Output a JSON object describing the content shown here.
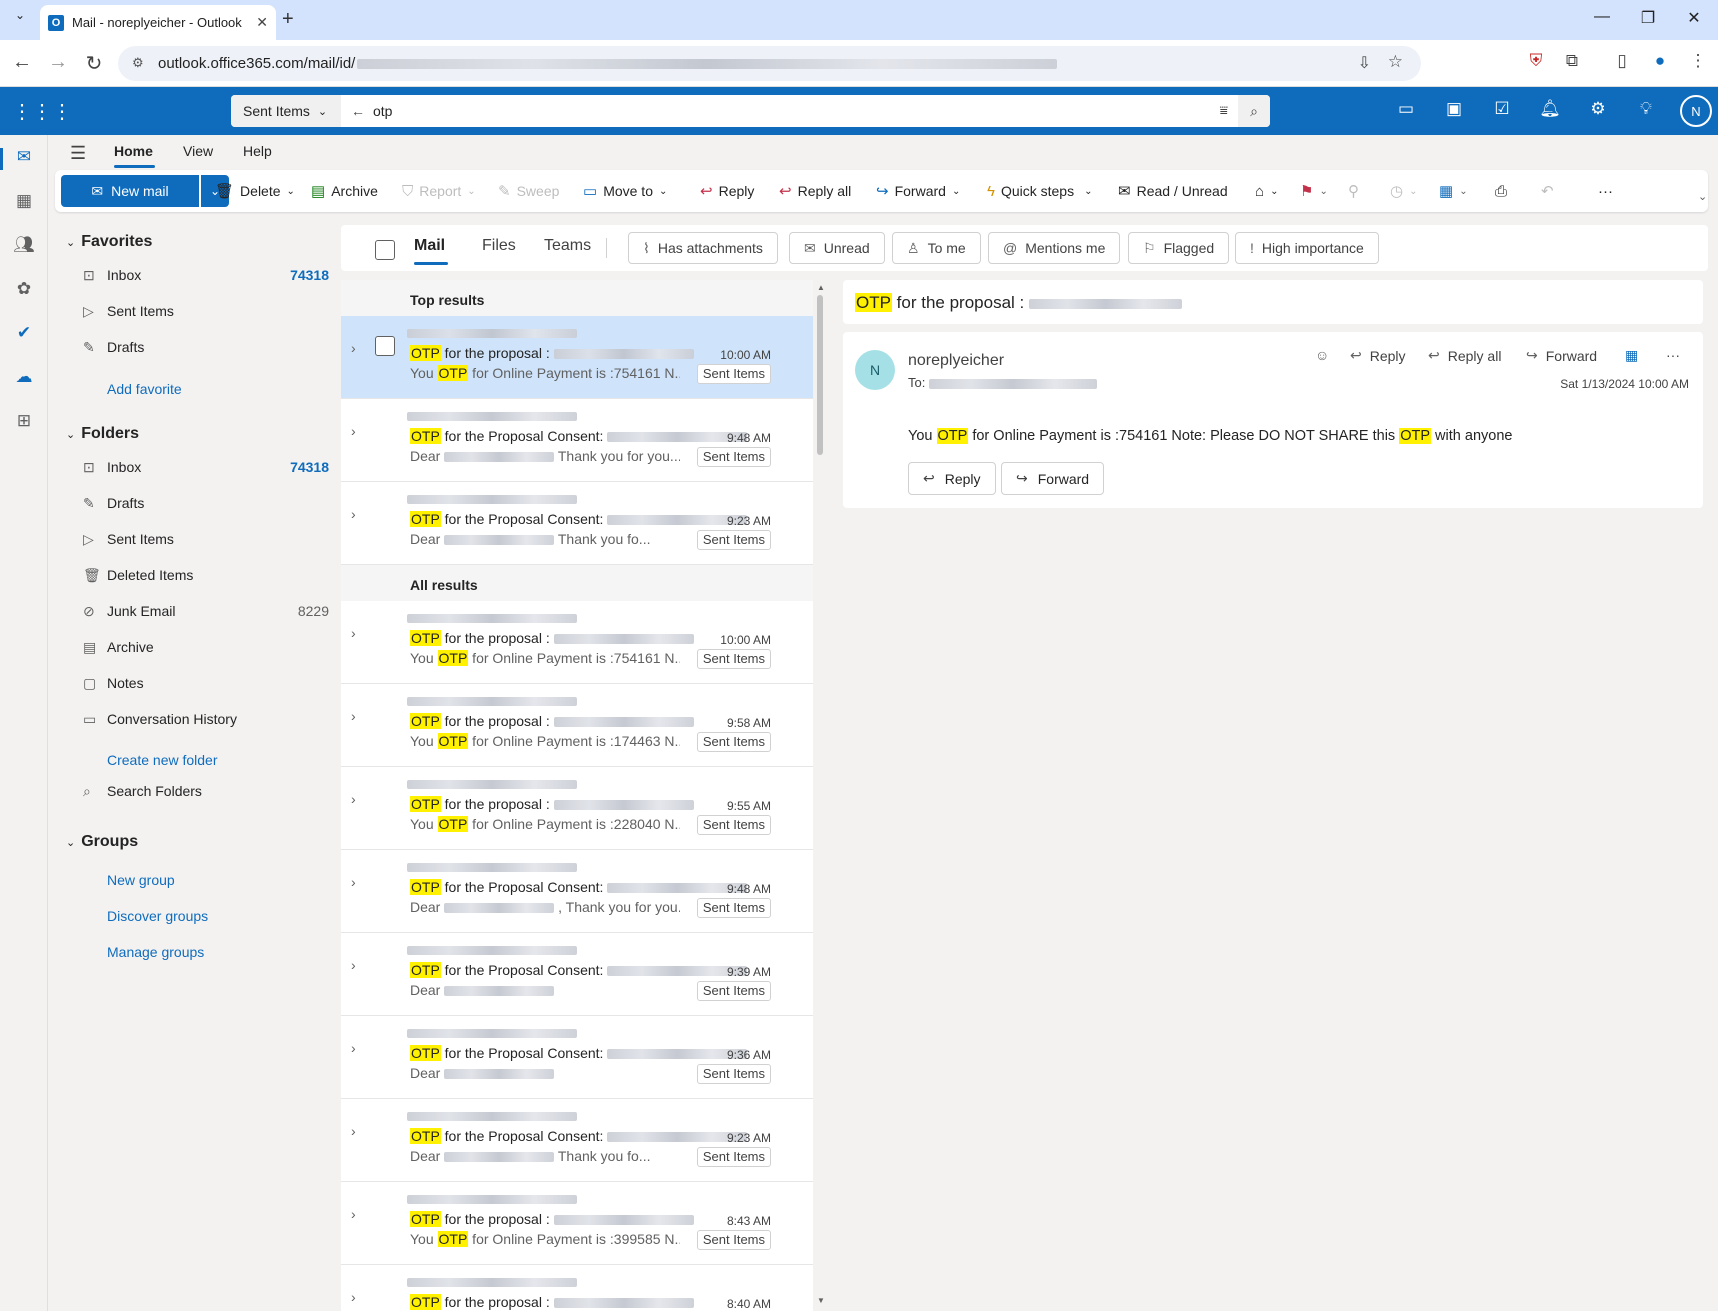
{
  "browser": {
    "tab_title": "Mail - noreplyeicher - Outlook",
    "url": "outlook.office365.com/mail/id/"
  },
  "suite": {
    "search_scope": "Sent Items",
    "search_query": "otp",
    "avatar_initial": "N"
  },
  "ribbon_tabs": [
    "Home",
    "View",
    "Help"
  ],
  "toolbar": {
    "new_mail": "New mail",
    "delete": "Delete",
    "archive": "Archive",
    "report": "Report",
    "sweep": "Sweep",
    "move_to": "Move to",
    "reply": "Reply",
    "reply_all": "Reply all",
    "forward": "Forward",
    "quick_steps": "Quick steps",
    "read_unread": "Read / Unread"
  },
  "folders": {
    "favorites_header": "Favorites",
    "favorites": [
      {
        "label": "Inbox",
        "count": "74318"
      },
      {
        "label": "Sent Items",
        "count": ""
      },
      {
        "label": "Drafts",
        "count": ""
      }
    ],
    "add_favorite": "Add favorite",
    "folders_header": "Folders",
    "items": [
      {
        "label": "Inbox",
        "count": "74318"
      },
      {
        "label": "Drafts",
        "count": ""
      },
      {
        "label": "Sent Items",
        "count": ""
      },
      {
        "label": "Deleted Items",
        "count": ""
      },
      {
        "label": "Junk Email",
        "count": "8229"
      },
      {
        "label": "Archive",
        "count": ""
      },
      {
        "label": "Notes",
        "count": ""
      },
      {
        "label": "Conversation History",
        "count": ""
      }
    ],
    "create_folder": "Create new folder",
    "search_folders": "Search Folders",
    "groups_header": "Groups",
    "groups_links": [
      "New group",
      "Discover groups",
      "Manage groups"
    ]
  },
  "filters": {
    "tabs": [
      "Mail",
      "Files",
      "Teams"
    ],
    "chips": [
      "Has attachments",
      "Unread",
      "To me",
      "Mentions me",
      "Flagged",
      "High importance"
    ]
  },
  "results": {
    "top_header": "Top results",
    "all_header": "All results",
    "tag": "Sent Items",
    "messages": [
      {
        "subject_rest": " for the proposal :",
        "time": "10:00 AM",
        "preview": "You OTP for Online Payment is :754161 N..."
      },
      {
        "subject_rest": " for the Proposal Consent:",
        "time": "9:48 AM",
        "preview": "Dear  Thank you for you..."
      },
      {
        "subject_rest": " for the Proposal Consent:",
        "time": "9:23 AM",
        "preview": "Dear  Thank you fo..."
      },
      {
        "subject_rest": " for the proposal :",
        "time": "10:00 AM",
        "preview": "You OTP for Online Payment is :754161 N..."
      },
      {
        "subject_rest": " for the proposal :",
        "time": "9:58 AM",
        "preview": "You OTP for Online Payment is :174463 N..."
      },
      {
        "subject_rest": " for the proposal :",
        "time": "9:55 AM",
        "preview": "You OTP for Online Payment is :228040 N..."
      },
      {
        "subject_rest": " for the Proposal Consent:",
        "time": "9:48 AM",
        "preview": "Dear , Thank you for you..."
      },
      {
        "subject_rest": " for the Proposal Consent:",
        "time": "9:39 AM",
        "preview": "Dear"
      },
      {
        "subject_rest": " for the Proposal Consent:",
        "time": "9:36 AM",
        "preview": "Dear"
      },
      {
        "subject_rest": " for the Proposal Consent:",
        "time": "9:23 AM",
        "preview": "Dear  Thank you fo..."
      },
      {
        "subject_rest": " for the proposal :",
        "time": "8:43 AM",
        "preview": "You OTP for Online Payment is :399585 N..."
      },
      {
        "subject_rest": " for the proposal :",
        "time": "8:40 AM",
        "preview": ""
      }
    ]
  },
  "highlight_word": "OTP",
  "reading": {
    "subject_rest": " for the proposal :",
    "sender": "noreplyeicher",
    "to_label": "To:",
    "date": "Sat 1/13/2024 10:00 AM",
    "reply": "Reply",
    "reply_all": "Reply all",
    "forward": "Forward",
    "body_1": "You ",
    "body_2": " for Online Payment is :754161 Note: Please DO NOT SHARE this ",
    "body_3": " with anyone",
    "avatar_initial": "N"
  },
  "colors": {
    "accent": "#0f6cbd",
    "highlight": "#fff100",
    "selected": "#cfe4fa"
  }
}
